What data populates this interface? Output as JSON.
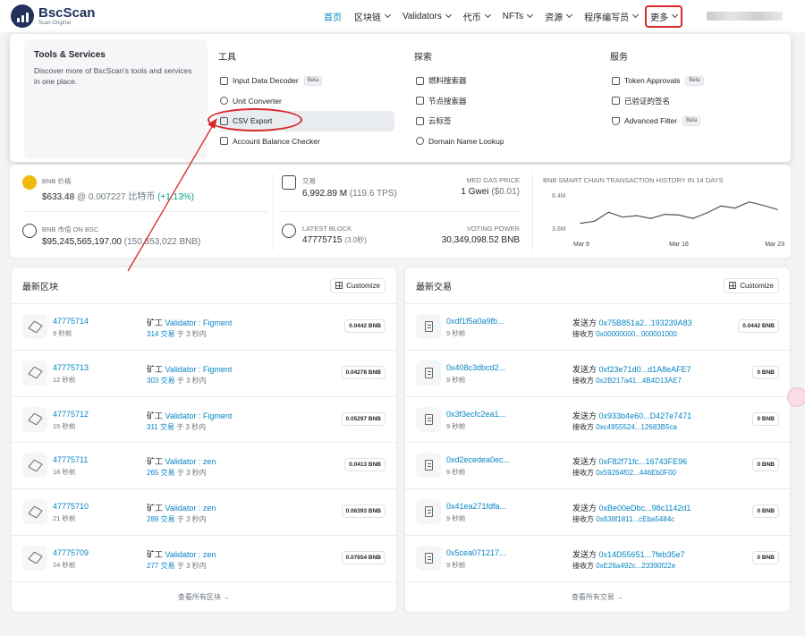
{
  "header": {
    "logo_name": "BscScan",
    "logo_sub": "Scan Original",
    "nav": [
      {
        "label": "首页",
        "active": true,
        "chevron": false
      },
      {
        "label": "区块链",
        "chevron": true
      },
      {
        "label": "Validators",
        "chevron": true
      },
      {
        "label": "代币",
        "chevron": true
      },
      {
        "label": "NFTs",
        "chevron": true
      },
      {
        "label": "资源",
        "chevron": true
      },
      {
        "label": "程序编写员",
        "chevron": true
      }
    ],
    "more_label": "更多"
  },
  "dropdown": {
    "tools_title": "Tools & Services",
    "tools_desc": "Discover more of BscScan's tools and services in one place.",
    "col_tools": {
      "title": "工具",
      "items": [
        "Input Data Decoder",
        "Unit Converter",
        "CSV Export",
        "Account Balance Checker"
      ],
      "beta_label": "Beta"
    },
    "col_explore": {
      "title": "探索",
      "items": [
        "燃料搜索器",
        "节点搜索器",
        "云标签",
        "Domain Name Lookup"
      ]
    },
    "col_services": {
      "title": "服务",
      "items": [
        "Token Approvals",
        "已验证的签名",
        "Advanced Filter"
      ],
      "beta_label": "Beta"
    }
  },
  "stats": {
    "bnb_price_label": "BNB 价格",
    "bnb_price": "$633.48",
    "bnb_price_btc": "@ 0.007227 比特币",
    "bnb_price_change": "(+1.13%)",
    "market_cap_label": "BNB 市值 ON BSC",
    "market_cap": "$95,245,565,197.00",
    "market_cap_bnb": "(150,353,022 BNB)",
    "tx_label": "交易",
    "tx_value": "6,992.89 M",
    "tx_tps": "(119.6 TPS)",
    "gas_label": "MED GAS PRICE",
    "gas_value": "1 Gwei",
    "gas_usd": "($0.01)",
    "latest_block_label": "LATEST BLOCK",
    "latest_block": "47775715",
    "latest_block_time": "(3.0秒)",
    "voting_label": "VOTING POWER",
    "voting_value": "30,349,098.52 BNB",
    "chart_title": "BNB SMART CHAIN TRANSACTION HISTORY IN 14 DAYS"
  },
  "chart_data": {
    "type": "line",
    "title": "BNB SMART CHAIN TRANSACTION HISTORY IN 14 DAYS",
    "y_tick_labels": [
      "8.4M",
      "3.6M"
    ],
    "x_tick_labels": [
      "Mar 9",
      "Mar 16",
      "Mar 23"
    ],
    "x": [
      "Mar 9",
      "Mar 10",
      "Mar 11",
      "Mar 12",
      "Mar 13",
      "Mar 14",
      "Mar 15",
      "Mar 16",
      "Mar 17",
      "Mar 18",
      "Mar 19",
      "Mar 20",
      "Mar 21",
      "Mar 22",
      "Mar 23"
    ],
    "values": [
      4.3,
      4.6,
      5.9,
      5.2,
      5.4,
      5.0,
      5.6,
      5.5,
      5.0,
      5.8,
      6.8,
      6.5,
      7.4,
      6.9,
      6.3
    ],
    "ylim": [
      3.6,
      8.4
    ]
  },
  "blocks": {
    "title": "最新区块",
    "customize": "Customize",
    "footer": "查看所有区块 →",
    "miner_label": "矿工",
    "tx_word": "交易",
    "in_word": "于",
    "items": [
      {
        "id": "47775714",
        "time": "9 秒前",
        "validator": "Validator : Figment",
        "txs": "314",
        "dur": "3 秒内",
        "amount": "0.0442 BNB"
      },
      {
        "id": "47775713",
        "time": "12 秒前",
        "validator": "Validator : Figment",
        "txs": "303",
        "dur": "3 秒内",
        "amount": "0.04278 BNB"
      },
      {
        "id": "47775712",
        "time": "15 秒前",
        "validator": "Validator : Figment",
        "txs": "311",
        "dur": "3 秒内",
        "amount": "0.05297 BNB"
      },
      {
        "id": "47775711",
        "time": "18 秒前",
        "validator": "Validator : zen",
        "txs": "265",
        "dur": "3 秒内",
        "amount": "0.0413 BNB"
      },
      {
        "id": "47775710",
        "time": "21 秒前",
        "validator": "Validator : zen",
        "txs": "289",
        "dur": "3 秒内",
        "amount": "0.06393 BNB"
      },
      {
        "id": "47775709",
        "time": "24 秒前",
        "validator": "Validator : zen",
        "txs": "277",
        "dur": "3 秒内",
        "amount": "0.07654 BNB"
      }
    ]
  },
  "txs": {
    "title": "最新交易",
    "customize": "Customize",
    "footer": "查看所有交易 →",
    "from_label": "发送方",
    "to_label": "接收方",
    "items": [
      {
        "hash": "0xdf1f5a0a9fb...",
        "time": "9 秒前",
        "from": "0x75B851a2...193239A83",
        "to": "0x00000000...000001000",
        "amount": "0.0442 BNB"
      },
      {
        "hash": "0x408c3dbcd2...",
        "time": "9 秒前",
        "from": "0xf23e71d0...d1A8eAFE7",
        "to": "0x2B217a41...4B4D13AE7",
        "amount": "0 BNB"
      },
      {
        "hash": "0x3f3ecfc2ea1...",
        "time": "9 秒前",
        "from": "0x933b4e60...D427e7471",
        "to": "0xc4955524...12683B5ca",
        "amount": "0 BNB"
      },
      {
        "hash": "0xd2ecedea0ec...",
        "time": "9 秒前",
        "from": "0xF82f71fc...16743FE96",
        "to": "0x59264f02...446Eb0F00",
        "amount": "0 BNB"
      },
      {
        "hash": "0x41ea271fdfa...",
        "time": "9 秒前",
        "from": "0xBe00eDbc...98c1142d1",
        "to": "0x838f1811...cEba5484c",
        "amount": "0 BNB"
      },
      {
        "hash": "0x5cea071217...",
        "time": "9 秒前",
        "from": "0x14D55651...7feb35e7",
        "to": "0xE26a492c...23390f22e",
        "amount": "0 BNB"
      }
    ]
  }
}
